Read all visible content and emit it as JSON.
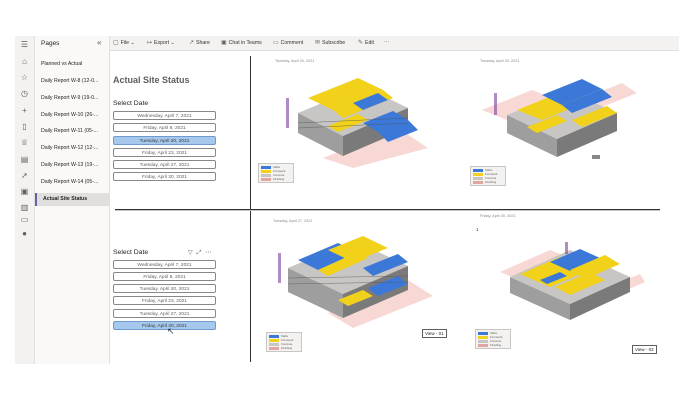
{
  "colors": {
    "accent": "#6264a7",
    "selected": "#a6c8ec",
    "yellow": "#f2d11a",
    "blue": "#3c78d8",
    "pink": "#f4c7c3"
  },
  "rail_icons": [
    "menu-icon",
    "home-icon",
    "star-icon",
    "clock-icon",
    "plus-icon",
    "clipboard-icon",
    "trophy-icon",
    "board-icon",
    "rocket-icon",
    "monitor-icon",
    "book-icon",
    "screen-share-icon",
    "user-icon"
  ],
  "pages": {
    "title": "Pages",
    "items": [
      {
        "label": "Planned vs Actual"
      },
      {
        "label": "Daily Report W-8 (12-0..."
      },
      {
        "label": "Daily Report W-9 (19-0..."
      },
      {
        "label": "Daily Report W-10 (26-..."
      },
      {
        "label": "Daily Report W-11 (05-..."
      },
      {
        "label": "Daily Report W-12 (12-..."
      },
      {
        "label": "Daily Report W-13 (19-..."
      },
      {
        "label": "Daily Report W-14 (05-..."
      },
      {
        "label": "Actual Site Status"
      }
    ]
  },
  "toolbar": {
    "file": "File",
    "export": "Export",
    "share": "Share",
    "chat": "Chat in Teams",
    "comment": "Comment",
    "subscribe": "Subscribe",
    "edit": "Edit",
    "more": "···"
  },
  "report": {
    "title": "Actual Site Status",
    "select_label_1": "Select Date",
    "select_label_2": "Select Date",
    "dates_1": [
      "Wednesday, April 7, 2021",
      "Friday, April 9, 2021",
      "Tuesday, April 20, 2021",
      "Friday, April 23, 2021",
      "Tuesday, April 27, 2021",
      "Friday, April 30, 2021"
    ],
    "selected_1": 2,
    "dates_2": [
      "Wednesday, April 7, 2021",
      "Friday, April 9, 2021",
      "Tuesday, April 20, 2021",
      "Friday, April 23, 2021",
      "Tuesday, April 27, 2021",
      "Friday, April 30, 2021"
    ],
    "selected_2": 5
  },
  "views": {
    "cap_tl": "Tuesday, April 20, 2021",
    "cap_tr": "Tuesday, April 20, 2021",
    "cap_bl": "Tuesday, April 27, 2021",
    "cap_br": "Friday, April 30, 2021",
    "view_01": "View - 01",
    "view_02": "View - 02",
    "one": "1"
  },
  "legend": [
    "Slabs",
    "Formwork",
    "Concrete",
    "Finishing"
  ]
}
